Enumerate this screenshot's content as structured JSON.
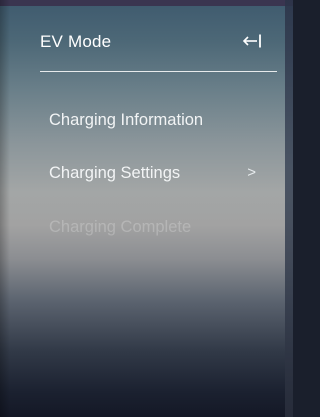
{
  "header": {
    "title": "EV Mode",
    "collapse_icon": "collapse-left-arrow-icon"
  },
  "menu": {
    "items": [
      {
        "label": "Charging Information",
        "enabled": true,
        "has_submenu": false
      },
      {
        "label": "Charging Settings",
        "enabled": true,
        "has_submenu": true,
        "chevron": ">"
      },
      {
        "label": "Charging Complete",
        "enabled": false,
        "has_submenu": false
      }
    ]
  },
  "colors": {
    "text": "#ffffff",
    "disabled_text": "#ffffff38",
    "divider": "#ffffffd9"
  }
}
